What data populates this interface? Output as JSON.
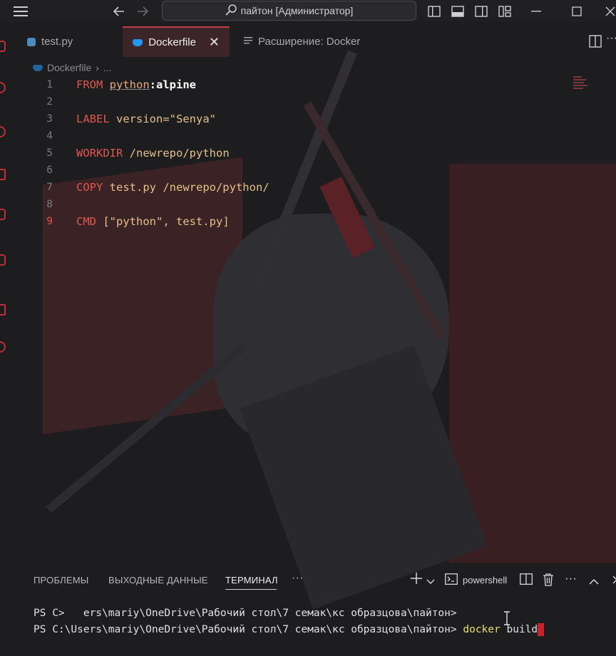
{
  "titlebar": {
    "search_text": "пайтон [Администратор]"
  },
  "tabs": [
    {
      "label": "test.py"
    },
    {
      "label": "Dockerfile",
      "close": "✕"
    },
    {
      "label": "Расширение: Docker"
    }
  ],
  "breadcrumb": {
    "file": "Dockerfile",
    "sep": "›",
    "more": "..."
  },
  "editor": {
    "lines": [
      {
        "num": "1",
        "kw": "FROM",
        "img": "python",
        "tag": ":alpine"
      },
      {
        "num": "2"
      },
      {
        "num": "3",
        "kw": "LABEL",
        "rest": "version=\"Senya\""
      },
      {
        "num": "4"
      },
      {
        "num": "5",
        "kw": "WORKDIR",
        "rest": "/newrepo/python"
      },
      {
        "num": "6"
      },
      {
        "num": "7",
        "kw": "COPY",
        "rest": "test.py /newrepo/python/"
      },
      {
        "num": "8"
      },
      {
        "num": "9",
        "kw": "CMD",
        "rest": "[\"python\", test.py]"
      }
    ]
  },
  "panel": {
    "tabs": [
      "ПРОБЛЕМЫ",
      "ВЫХОДНЫЕ ДАННЫЕ",
      "ТЕРМИНАЛ"
    ],
    "more": "···",
    "shell": "powershell"
  },
  "terminal": {
    "line1": "PS C>   ers\\mariy\\OneDrive\\Рабочий стол\\7 семак\\кс образцова\\пайтон>",
    "line2_prompt": "PS C:\\Users\\mariy\\OneDrive\\Рабочий стол\\7 семак\\кс образцова\\пайтон> ",
    "line2_cmd": "docker",
    "line2_args": " build"
  },
  "colors": {
    "accent": "#c23a44",
    "keyword": "#e0574f",
    "string": "#f0a86a"
  }
}
